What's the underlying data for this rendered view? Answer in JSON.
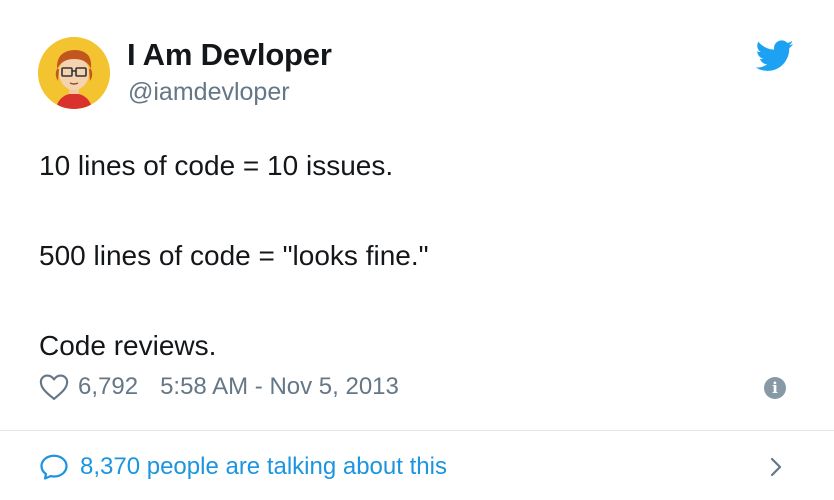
{
  "user": {
    "display_name": "I Am Devloper",
    "handle": "@iamdevloper"
  },
  "tweet": {
    "lines": [
      "10 lines of code = 10 issues.",
      "500 lines of code = \"looks fine.\"",
      "Code reviews."
    ],
    "like_count": "6,792",
    "timestamp": "5:58 AM - Nov 5, 2013"
  },
  "footer": {
    "talking_text": "8,370 people are talking about this"
  },
  "icons": {
    "avatar": "avatar-cartoon-developer",
    "brand": "twitter-bird-icon",
    "like": "heart-outline-icon",
    "info": "info-icon",
    "reply": "speech-bubble-icon",
    "more": "chevron-right-icon"
  },
  "colors": {
    "brand": "#1da1f2",
    "link": "#1b95e0",
    "secondary_text": "#657786",
    "primary_text": "#14171a",
    "divider": "#e1e8ed"
  }
}
